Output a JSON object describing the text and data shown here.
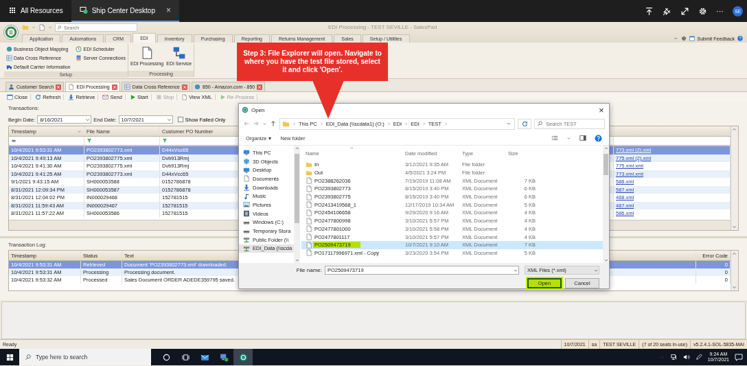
{
  "top_bar": {
    "tabs": [
      {
        "label": "All Resources",
        "selected": false
      },
      {
        "label": "Ship Center Desktop",
        "selected": true
      }
    ],
    "close": "×",
    "more": "···",
    "avatar": "SE"
  },
  "app": {
    "title": "EDI Processing - TEST SEVILLE - SalesPad",
    "search_placeholder": "Search",
    "submit_feedback": "Submit Feedback",
    "ribbon_tabs": [
      {
        "label": "Application",
        "selected": false
      },
      {
        "label": "Automations",
        "selected": false
      },
      {
        "label": "CRM",
        "selected": false
      },
      {
        "label": "EDI",
        "selected": true
      },
      {
        "label": "Inventory",
        "selected": false
      },
      {
        "label": "Purchasing",
        "selected": false
      },
      {
        "label": "Reporting",
        "selected": false
      },
      {
        "label": "Returns Management",
        "selected": false
      },
      {
        "label": "Sales",
        "selected": false
      },
      {
        "label": "Setup / Utilities",
        "selected": false
      }
    ],
    "ribbon_groups": [
      {
        "label": "Setup",
        "kind": "small",
        "items": [
          "Business Object Mapping",
          "Data Cross Reference",
          "Default Carrier Information",
          "EDI Scheduler",
          "Server Connections"
        ]
      },
      {
        "label": "Processing",
        "kind": "large",
        "items": [
          "EDI Processing",
          "EDI Service"
        ]
      }
    ],
    "document_tabs": [
      {
        "label": "Customer Search",
        "selected": false
      },
      {
        "label": "EDI Processing",
        "selected": true
      },
      {
        "label": "Data Cross Reference",
        "selected": false
      },
      {
        "label": "850 - Amazon.com - 850",
        "selected": false
      }
    ],
    "toolbar": [
      {
        "label": "Close",
        "disabled": false
      },
      {
        "label": "Refresh",
        "disabled": false
      },
      {
        "label": "Retrieve",
        "disabled": false
      },
      {
        "label": "Send",
        "disabled": false
      },
      {
        "label": "Start",
        "disabled": false
      },
      {
        "label": "Stop",
        "disabled": true
      },
      {
        "label": "View XML",
        "disabled": false
      },
      {
        "label": "Re-Process",
        "disabled": true
      }
    ]
  },
  "transactions": {
    "label": "Transactions:",
    "begin_date_label": "Begin Date:",
    "begin_date": "8/16/2021",
    "end_date_label": "End Date:",
    "end_date": "10/7/2021",
    "show_failed_only": {
      "label": "Show Failed Only",
      "checked": false
    },
    "columns": [
      "Timestamp",
      "File Name",
      "Customer PO Number"
    ],
    "rows": [
      {
        "timestamp": "10/4/2021 9:53:31 AM",
        "file_name": "PO2393802773.xml",
        "customer_po_number": "D44xVcc65",
        "column_4": "773.xml (2).xml",
        "selected": true
      },
      {
        "timestamp": "10/4/2021 9:49:13 AM",
        "file_name": "PO2393802775.xml",
        "customer_po_number": "Dvb913Rmj",
        "column_4": "775.xml (2).xml",
        "selected": false
      },
      {
        "timestamp": "10/4/2021 9:41:30 AM",
        "file_name": "PO2393802775.xml",
        "customer_po_number": "Dvb913Rmj",
        "column_4": "775.xml.xml",
        "selected": false
      },
      {
        "timestamp": "10/4/2021 9:41:25 AM",
        "file_name": "PO2393802773.xml",
        "customer_po_number": "D44xVcc65",
        "column_4": "773.xml.xml",
        "selected": false
      },
      {
        "timestamp": "9/1/2021 9:43:15 AM",
        "file_name": "SH000053588",
        "customer_po_number": "0152786878",
        "column_4": "588.xml",
        "selected": false
      },
      {
        "timestamp": "8/31/2021 12:09:34 PM",
        "file_name": "SH000053587",
        "customer_po_number": "0152786878",
        "column_4": "587.xml",
        "selected": false
      },
      {
        "timestamp": "8/31/2021 12:04:02 PM",
        "file_name": "IN000029468",
        "customer_po_number": "152781515",
        "column_4": "468.xml",
        "selected": false
      },
      {
        "timestamp": "8/31/2021 11:59:43 AM",
        "file_name": "IN000029467",
        "customer_po_number": "152781515",
        "column_4": "467.xml",
        "selected": false
      },
      {
        "timestamp": "8/31/2021 11:57:22 AM",
        "file_name": "SH000053586",
        "customer_po_number": "152781515",
        "column_4": "586.xml",
        "selected": false
      }
    ]
  },
  "transaction_log": {
    "label": "Transaction Log:",
    "columns": [
      "Timestamp",
      "Status",
      "Text",
      "Error Code"
    ],
    "rows": [
      {
        "timestamp": "10/4/2021 9:53:31 AM",
        "status": "Retrieved",
        "text": "Document 'PO2393802773.xml' downloaded.",
        "error_code": "0",
        "selected": true
      },
      {
        "timestamp": "10/4/2021 9:53:31 AM",
        "status": "Processing",
        "text": "Processing document.",
        "error_code": "0",
        "selected": false
      },
      {
        "timestamp": "10/4/2021 9:53:32 AM",
        "status": "Processed",
        "text": "Sales Document ORDER ADEDE359795 saved.",
        "error_code": "0",
        "selected": false
      }
    ]
  },
  "status_bar": {
    "status": "Ready",
    "segments": [
      "10/7/2021",
      "sa",
      "TEST SEVILLE",
      "(7 of 20 seats in-use)",
      "v5.2.4.1-SOL-5835-MAI"
    ]
  },
  "open_dialog": {
    "title": "Open",
    "close": "×",
    "path": [
      "This PC",
      "EDI_Data (\\\\scdata1) (O:)",
      "EDI",
      "EDI",
      "TEST"
    ],
    "search_placeholder": "Search TEST",
    "organize": "Organize ▾",
    "new_folder": "New folder",
    "nav": [
      {
        "label": "This PC",
        "selected": false
      },
      {
        "label": "3D Objects",
        "selected": false
      },
      {
        "label": "Desktop",
        "selected": false
      },
      {
        "label": "Documents",
        "selected": false
      },
      {
        "label": "Downloads",
        "selected": false
      },
      {
        "label": "Music",
        "selected": false
      },
      {
        "label": "Pictures",
        "selected": false
      },
      {
        "label": "Videos",
        "selected": false
      },
      {
        "label": "Windows (C:)",
        "selected": false
      },
      {
        "label": "Temporary Stora",
        "selected": false
      },
      {
        "label": "Public Folder (\\\\",
        "selected": false
      },
      {
        "label": "EDI_Data (\\\\scda",
        "selected": true
      }
    ],
    "columns": [
      "Name",
      "Date modified",
      "Type",
      "Size"
    ],
    "files": [
      {
        "kind": "folder",
        "name": "In",
        "date": "3/12/2021 9:35 AM",
        "type": "File folder",
        "selected": false
      },
      {
        "kind": "folder",
        "name": "Out",
        "date": "4/5/2021 3:24 PM",
        "type": "File folder",
        "selected": false
      },
      {
        "kind": "file",
        "name": "PO2388262036",
        "date": "7/19/2019 11:08 AM",
        "type": "XML Document",
        "size": "7 KB",
        "selected": false
      },
      {
        "kind": "file",
        "name": "PO2393802773",
        "date": "8/15/2019 3:40 PM",
        "type": "XML Document",
        "size": "6 KB",
        "selected": false
      },
      {
        "kind": "file",
        "name": "PO2393802775",
        "date": "8/15/2019 3:40 PM",
        "type": "XML Document",
        "size": "6 KB",
        "selected": false
      },
      {
        "kind": "file",
        "name": "PO2413419568_1",
        "date": "12/17/2019 10:34 AM",
        "type": "XML Document",
        "size": "5 KB",
        "selected": false
      },
      {
        "kind": "file",
        "name": "PO2454106658",
        "date": "9/29/2020 9:16 AM",
        "type": "XML Document",
        "size": "4 KB",
        "selected": false
      },
      {
        "kind": "file",
        "name": "PO2477800998",
        "date": "3/10/2021 5:57 PM",
        "type": "XML Document",
        "size": "4 KB",
        "selected": false
      },
      {
        "kind": "file",
        "name": "PO2477801000",
        "date": "3/10/2021 5:58 PM",
        "type": "XML Document",
        "size": "4 KB",
        "selected": false
      },
      {
        "kind": "file",
        "name": "PO2477801117",
        "date": "3/10/2021 5:57 PM",
        "type": "XML Document",
        "size": "4 KB",
        "selected": false
      },
      {
        "kind": "file",
        "name": "PO2509473719",
        "date": "10/7/2021 9:10 AM",
        "type": "XML Document",
        "size": "7 KB",
        "selected": true
      },
      {
        "kind": "file",
        "name": "PO17117996971.xml - Copy",
        "date": "3/23/2020 3:54 PM",
        "type": "XML Document",
        "size": "5 KB",
        "selected": false
      }
    ],
    "file_name_label": "File name:",
    "file_name": "PO2509473719",
    "file_type": "XML Files (*.xml)",
    "buttons": [
      {
        "label": "Open",
        "highlighted": true
      },
      {
        "label": "Cancel",
        "highlighted": false
      }
    ]
  },
  "callout": {
    "text": "Step 3: File Explorer will open. Navigate to where you have the test file stored, select it and click 'Open'."
  },
  "taskbar": {
    "search_placeholder": "Type here to search",
    "time": "9:24 AM",
    "date": "10/7/2021"
  }
}
